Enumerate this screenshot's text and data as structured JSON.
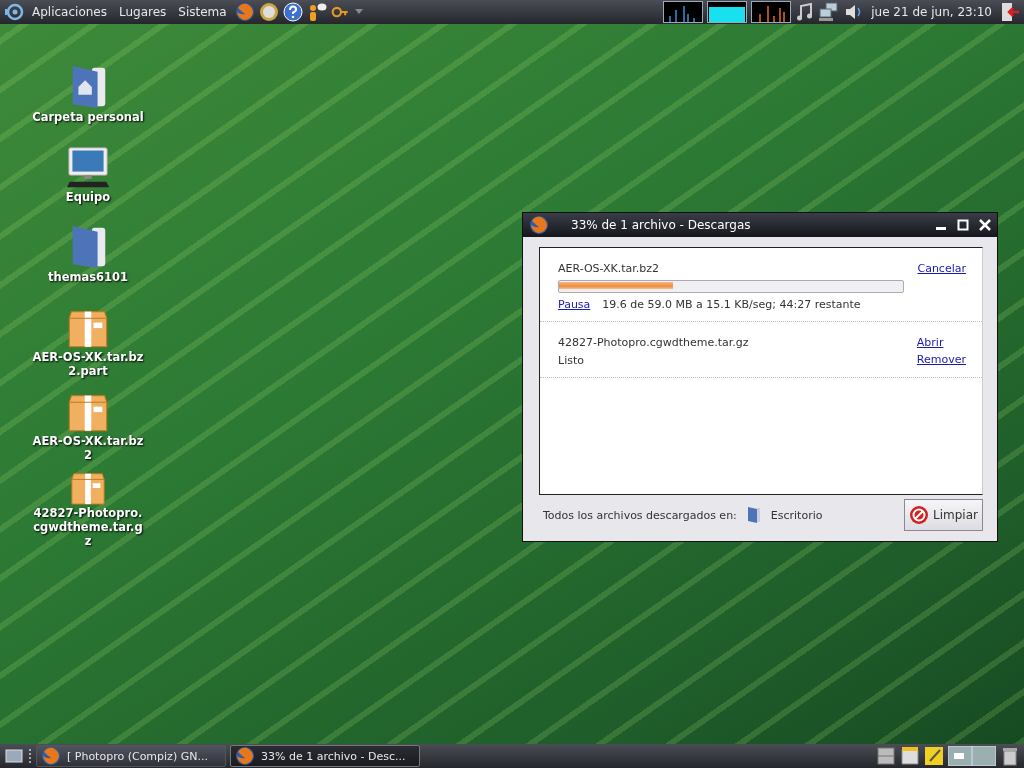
{
  "top_panel": {
    "menus": [
      "Aplicaciones",
      "Lugares",
      "Sistema"
    ],
    "clock": "jue 21 de jun, 23:10"
  },
  "desktop_icons": [
    {
      "label": "Carpeta personal",
      "kind": "home"
    },
    {
      "label": "Equipo",
      "kind": "computer"
    },
    {
      "label": "themas6101",
      "kind": "folder"
    },
    {
      "label": "AER-OS-XK.tar.bz2.part",
      "kind": "package"
    },
    {
      "label": "AER-OS-XK.tar.bz2",
      "kind": "package"
    },
    {
      "label": "42827-Photopro.cgwdtheme.tar.gz",
      "kind": "package"
    }
  ],
  "window": {
    "title": "33% de 1 archivo - Descargas",
    "downloads": [
      {
        "name": "AER-OS-XK.tar.bz2",
        "kind": "active",
        "level": 0.33,
        "pause": "Pausa",
        "status": "19.6 de 59.0 MB a 15.1 KB/seg; 44:27 restante",
        "actions": [
          "Cancelar"
        ]
      },
      {
        "name": "42827-Photopro.cgwdtheme.tar.gz",
        "kind": "done",
        "status": "Listo",
        "actions": [
          "Abrir",
          "Remover"
        ]
      }
    ],
    "footer": {
      "label": "Todos los archivos descargados en:",
      "folder": "Escritorio",
      "button": "Limpiar"
    }
  },
  "taskbar": {
    "tasks": [
      {
        "label": "[ Photopro (Compiz) GN...",
        "selected": false
      },
      {
        "label": "33% de 1 archivo - Desc...",
        "selected": true
      }
    ]
  }
}
